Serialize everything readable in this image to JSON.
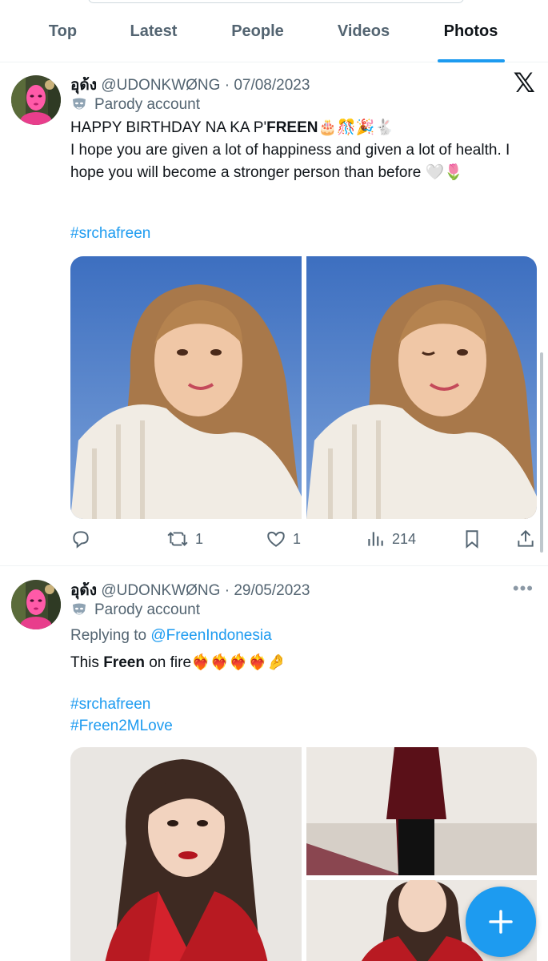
{
  "tabs": [
    {
      "label": "Top"
    },
    {
      "label": "Latest"
    },
    {
      "label": "People"
    },
    {
      "label": "Videos"
    },
    {
      "label": "Photos",
      "active": true
    }
  ],
  "tweets": [
    {
      "display_name": "อุด้ง",
      "handle": "@UDONKWØNG",
      "date": "07/08/2023",
      "sep": "·",
      "parody_label": "Parody account",
      "text_part1": "HAPPY BIRTHDAY NA KA P'",
      "text_bold": "FREEN",
      "text_emoji": "🎂🎊🎉🐇",
      "text_line2": "I hope you are given a lot of happiness and given a lot of health. I hope you will become a stronger person than before 🤍🌷",
      "hashtags": [
        "#srchafreen"
      ],
      "stats": {
        "replies": "",
        "retweets": "1",
        "likes": "1",
        "views": "214"
      }
    },
    {
      "display_name": "อุด้ง",
      "handle": "@UDONKWØNG",
      "date": "29/05/2023",
      "sep": "·",
      "parody_label": "Parody account",
      "replying_prefix": "Replying to ",
      "replying_to": "@FreenIndonesia",
      "text_part1": "This ",
      "text_bold": "Freen",
      "text_part2": " on fire❤️‍🔥❤️‍🔥❤️‍🔥❤️‍🔥🤌",
      "hashtags": [
        "#srchafreen",
        "#Freen2MLove"
      ]
    }
  ],
  "icons": {
    "x_logo": "𝕏",
    "more": "•••",
    "parody": "mask-icon",
    "reply": "reply-icon",
    "retweet": "retweet-icon",
    "like": "heart-icon",
    "views": "views-icon",
    "bookmark": "bookmark-icon",
    "share": "share-icon",
    "compose": "plus-icon"
  },
  "colors": {
    "accent": "#1d9bf0",
    "text": "#0f1419",
    "secondary": "#536471",
    "avatar_pink": "#e83e8c"
  }
}
